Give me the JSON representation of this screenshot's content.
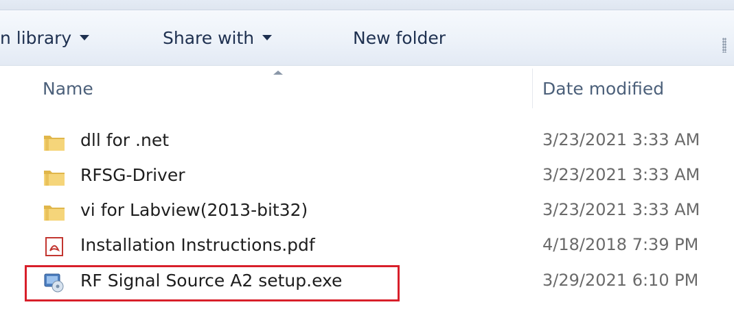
{
  "toolbar": {
    "include_label": "n library",
    "share_label": "Share with",
    "newfolder_label": "New folder"
  },
  "columns": {
    "name": "Name",
    "date_modified": "Date modified",
    "sorted_by": "Name",
    "sort_direction": "ascending"
  },
  "files": [
    {
      "name": "dll for .net",
      "date": "3/23/2021 3:33 AM",
      "icon": "folder-icon"
    },
    {
      "name": "RFSG-Driver",
      "date": "3/23/2021 3:33 AM",
      "icon": "folder-icon"
    },
    {
      "name": "vi for Labview(2013-bit32)",
      "date": "3/23/2021 3:33 AM",
      "icon": "folder-icon"
    },
    {
      "name": "Installation Instructions.pdf",
      "date": "4/18/2018 7:39 PM",
      "icon": "pdf-icon"
    },
    {
      "name": "RF Signal Source A2 setup.exe",
      "date": "3/29/2021 6:10 PM",
      "icon": "installer-icon"
    }
  ],
  "highlighted_file": "RF Signal Source A2 setup.exe",
  "colors": {
    "highlight_border": "#d81f2a",
    "toolbar_text": "#1e3050",
    "header_text": "#4c607a",
    "date_text": "#6a6a6a"
  }
}
